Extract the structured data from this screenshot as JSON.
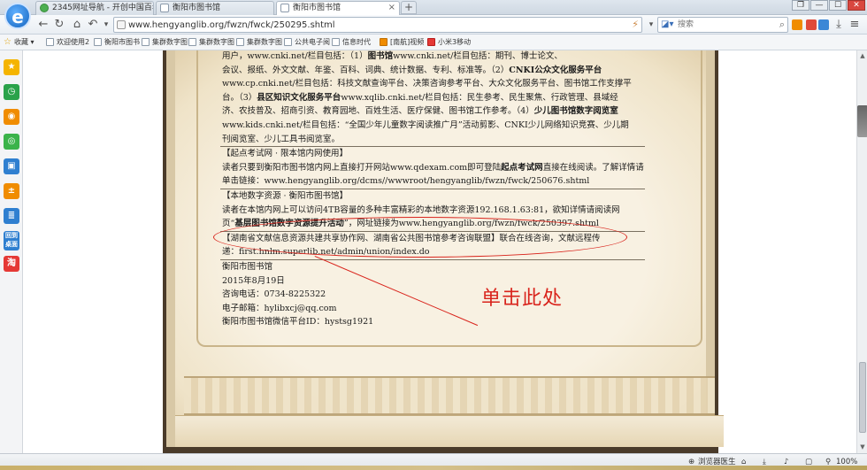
{
  "browser": {
    "tabs": [
      {
        "label": "2345网址导航 - 开创中国百年品",
        "active": false
      },
      {
        "label": "衡阳市图书馆",
        "active": false
      },
      {
        "label": "衡阳市图书馆",
        "active": true
      }
    ],
    "new_tab": "+",
    "logo": "e",
    "address": "www.hengyanglib.org/fwzn/fwck/250295.shtml",
    "search_placeholder": "搜索",
    "window_controls": [
      "❐",
      "—",
      "☐",
      "✕"
    ],
    "bookmarks": [
      {
        "label": "收藏",
        "icon": "star-icon"
      },
      {
        "label": "欢迎使用2"
      },
      {
        "label": "衡阳市图书"
      },
      {
        "label": "集群数字图"
      },
      {
        "label": "集群数字图"
      },
      {
        "label": "集群数字图"
      },
      {
        "label": "公共电子阅"
      },
      {
        "label": "信息时代"
      },
      {
        "label": "[南航]视频"
      },
      {
        "label": "小米3移动"
      }
    ],
    "sidebar_icons": [
      "star-icon",
      "clock-icon",
      "weibo-icon",
      "wechat-icon",
      "monitor-icon",
      "calculator-icon",
      "note-icon",
      "desktop-icon",
      "taobao-icon"
    ],
    "sidebar_labels": {
      "desktop": "回到桌面",
      "taobao": "淘"
    }
  },
  "page": {
    "lines": [
      {
        "id": "l1",
        "html_parts": [
          {
            "t": "用户，www.cnki.net/栏目包括：（1）"
          },
          {
            "t": "图书馆",
            "b": true
          },
          {
            "t": "www.cnki.net/栏目包括：期刊、博士论文、"
          }
        ]
      },
      {
        "id": "l2",
        "html_parts": [
          {
            "t": "会议、报纸、外文文献、年鉴、百科、词典、统计数据、专利、标准等。（2）"
          },
          {
            "t": "CNKI公众文化服务平台",
            "b": true
          }
        ]
      },
      {
        "id": "l3",
        "html_parts": [
          {
            "t": "www.cp.cnki.net/栏目包括：科技文献查询平台、决策咨询参考平台、大众文化服务平台、图书馆工作支撑平"
          }
        ]
      },
      {
        "id": "l4",
        "html_parts": [
          {
            "t": "台。（3）"
          },
          {
            "t": "县区知识文化服务平台",
            "b": true
          },
          {
            "t": "www.xqlib.cnki.net/栏目包括：民生参考、民生聚焦、行政管理、县域经"
          }
        ]
      },
      {
        "id": "l5",
        "html_parts": [
          {
            "t": "济、农技普及、招商引资、教育园地、百姓生活、医疗保健、图书馆工作参考。（4）"
          },
          {
            "t": "少儿图书馆数字阅览室",
            "b": true
          }
        ]
      },
      {
        "id": "l6",
        "html_parts": [
          {
            "t": "www.kids.cnki.net/栏目包括：“全国少年儿童数字阅读推广月”活动剪影、CNKI少儿网络知识竞赛、少儿期"
          }
        ]
      },
      {
        "id": "l7",
        "html_parts": [
          {
            "t": "刊阅览室、少儿工具书阅览室。"
          }
        ]
      }
    ],
    "section1": {
      "heading": "【起点考试网 · 限本馆内网使用】",
      "line1_a": "读者只要到衡阳市图书馆内网上直接打开网站www.qdexam.com即可登陆",
      "line1_b": "起点考试网",
      "line1_c": "直接在线阅读。了解详情请",
      "line2": "单击链接：www.hengyanglib.org/dcms//wwwroot/hengyanglib/fwzn/fwck/250676.shtml"
    },
    "section2": {
      "heading": "【本地数字资源 · 衡阳市图书馆】",
      "line1": "读者在本馆内网上可以访问4TB容量的多种丰富精彩的本地数字资源192.168.1.63:81，欲知详情请阅读网",
      "line2_a": "页“",
      "line2_b": "基层图书馆数字资源提升活动",
      "line2_c": "”，网址链接为www.hengyanglib.org/fwzn/fwck/250397.shtml"
    },
    "section3": {
      "line1": "【湖南省文献信息资源共建共享协作网、湖南省公共图书馆参考咨询联盟】联合在线咨询，文献远程传",
      "line2": "递：first.hnlm.superlib.net/admin/union/index.do"
    },
    "signature": {
      "org": "衡阳市图书馆",
      "date": "2015年8月19日",
      "phone": "咨询电话：0734-8225322",
      "email": "电子邮箱：hylibxcj@qq.com",
      "wechat": "衡阳市图书馆微信平台ID：hystsg1921"
    },
    "annotation": "单击此处",
    "annotation_color": "#d9241c"
  },
  "status": {
    "browser_doctor": "浏览器医生",
    "zoom": "100%"
  }
}
